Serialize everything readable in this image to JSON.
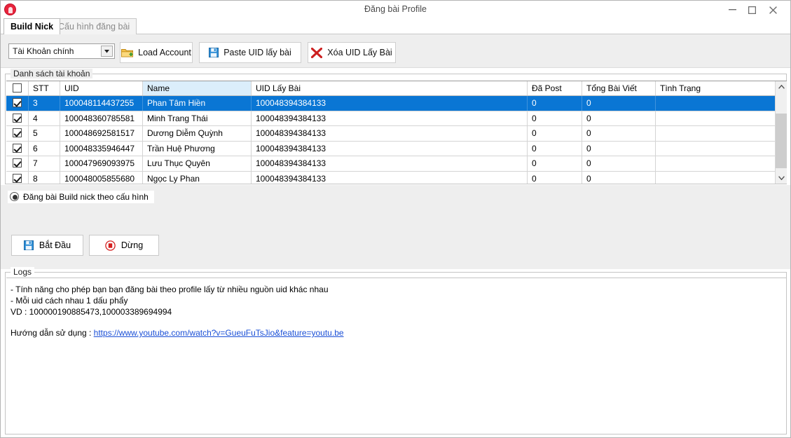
{
  "window": {
    "title": "Đăng bài Profile",
    "app_icon": "app-logo-icon",
    "minimize": "minimize-icon",
    "maximize": "maximize-icon",
    "close": "close-icon"
  },
  "tabs": [
    {
      "label": "Build Nick",
      "active": true
    },
    {
      "label": "Cấu hình đăng bài",
      "active": false
    }
  ],
  "toolbar": {
    "account_combo": {
      "value": "Tài Khoản chính",
      "arrow_icon": "chevron-down-icon"
    },
    "buttons": [
      {
        "label": "Load Account",
        "icon": "folder-add-icon"
      },
      {
        "label": "Paste UID lấy bài",
        "icon": "save-floppy-icon"
      },
      {
        "label": "Xóa UID Lấy Bài",
        "icon": "red-x-icon"
      }
    ]
  },
  "accounts_group": {
    "title": "Danh sách tài khoản",
    "columns": [
      {
        "key": "check",
        "label": ""
      },
      {
        "key": "stt",
        "label": "STT"
      },
      {
        "key": "uid",
        "label": "UID"
      },
      {
        "key": "name",
        "label": "Name",
        "highlight": true
      },
      {
        "key": "uidlay",
        "label": "UID Lấy Bài"
      },
      {
        "key": "post",
        "label": "Đã Post"
      },
      {
        "key": "total",
        "label": "Tổng Bài Viết"
      },
      {
        "key": "state",
        "label": "Tình Trạng"
      }
    ],
    "header_checkbox_checked": false,
    "rows": [
      {
        "checked": true,
        "stt": "3",
        "uid": "100048114437255",
        "name": "Phan Tâm Hiền",
        "uidlay": "100048394384133",
        "post": "0",
        "total": "0",
        "state": "",
        "selected": true
      },
      {
        "checked": true,
        "stt": "4",
        "uid": "100048360785581",
        "name": "Minh Trang Thái",
        "uidlay": "100048394384133",
        "post": "0",
        "total": "0",
        "state": "",
        "selected": false
      },
      {
        "checked": true,
        "stt": "5",
        "uid": "100048692581517",
        "name": "Dương Diễm Quỳnh",
        "uidlay": "100048394384133",
        "post": "0",
        "total": "0",
        "state": "",
        "selected": false
      },
      {
        "checked": true,
        "stt": "6",
        "uid": "100048335946447",
        "name": "Trần Huệ Phương",
        "uidlay": "100048394384133",
        "post": "0",
        "total": "0",
        "state": "",
        "selected": false
      },
      {
        "checked": true,
        "stt": "7",
        "uid": "100047969093975",
        "name": "Lưu Thục Quyên",
        "uidlay": "100048394384133",
        "post": "0",
        "total": "0",
        "state": "",
        "selected": false
      },
      {
        "checked": true,
        "stt": "8",
        "uid": "100048005855680",
        "name": "Ngọc Ly Phan",
        "uidlay": "100048394384133",
        "post": "0",
        "total": "0",
        "state": "",
        "selected": false
      }
    ],
    "scrollbar": {
      "up_icon": "chevron-up-icon",
      "down_icon": "chevron-down-icon"
    }
  },
  "options": {
    "radio_label": "Đăng bài Build nick theo cấu hình",
    "radio_selected": true
  },
  "actions": [
    {
      "label": "Bắt Đầu",
      "icon": "save-floppy-icon"
    },
    {
      "label": "Dừng",
      "icon": "stop-circle-icon"
    }
  ],
  "logs": {
    "title": "Logs",
    "line1": "- Tính năng cho phép bạn bạn đăng bài theo profile lấy từ nhiều nguồn uid khác nhau",
    "line2": "- Mỗi uid cách nhau 1 dấu phẩy",
    "line3": "VD : 100000190885473,100003389694994",
    "guide_label": "Hướng dẫn sử dụng : ",
    "guide_link": "https://www.youtube.com/watch?v=GueuFuTsJio&feature=youtu.be"
  },
  "colors": {
    "selection_blue": "#0a76d4",
    "header_highlight": "#dbeefb",
    "panel_gray": "#eeeeee",
    "link_blue": "#1a4fd6",
    "accent_red": "#e8243c"
  }
}
